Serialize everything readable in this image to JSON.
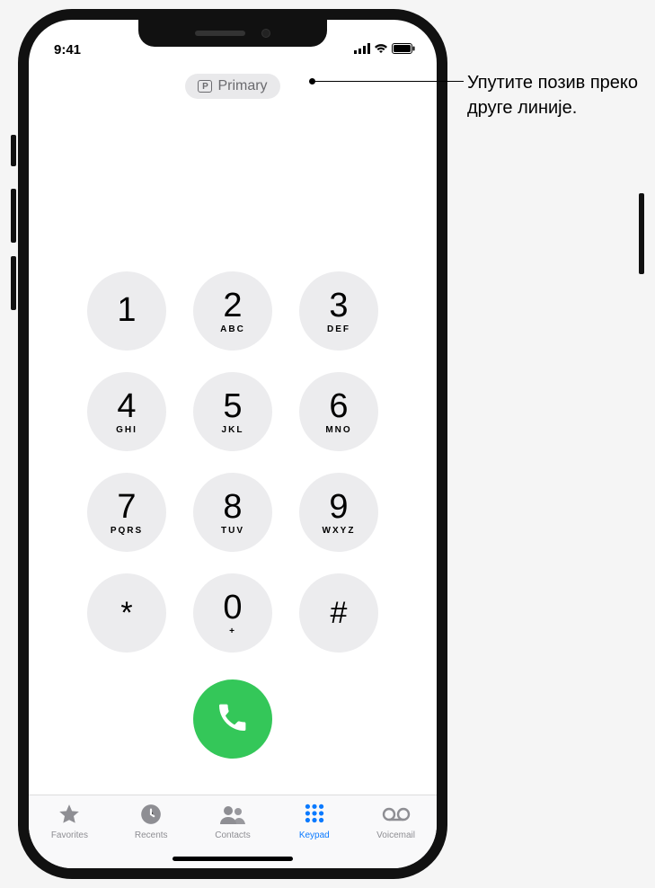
{
  "status": {
    "time": "9:41"
  },
  "line_selector": {
    "badge": "P",
    "label": "Primary"
  },
  "keypad": {
    "keys": [
      {
        "digit": "1",
        "letters": ""
      },
      {
        "digit": "2",
        "letters": "ABC"
      },
      {
        "digit": "3",
        "letters": "DEF"
      },
      {
        "digit": "4",
        "letters": "GHI"
      },
      {
        "digit": "5",
        "letters": "JKL"
      },
      {
        "digit": "6",
        "letters": "MNO"
      },
      {
        "digit": "7",
        "letters": "PQRS"
      },
      {
        "digit": "8",
        "letters": "TUV"
      },
      {
        "digit": "9",
        "letters": "WXYZ"
      },
      {
        "digit": "*",
        "letters": ""
      },
      {
        "digit": "0",
        "letters": "+"
      },
      {
        "digit": "#",
        "letters": ""
      }
    ]
  },
  "tabs": {
    "favorites": "Favorites",
    "recents": "Recents",
    "contacts": "Contacts",
    "keypad": "Keypad",
    "voicemail": "Voicemail",
    "active": "keypad"
  },
  "callout": {
    "text": "Упутите позив преко друге линије."
  },
  "colors": {
    "accent": "#0a7aff",
    "call_green": "#34c759",
    "inactive": "#8e8e93",
    "key_bg": "#ececee"
  }
}
